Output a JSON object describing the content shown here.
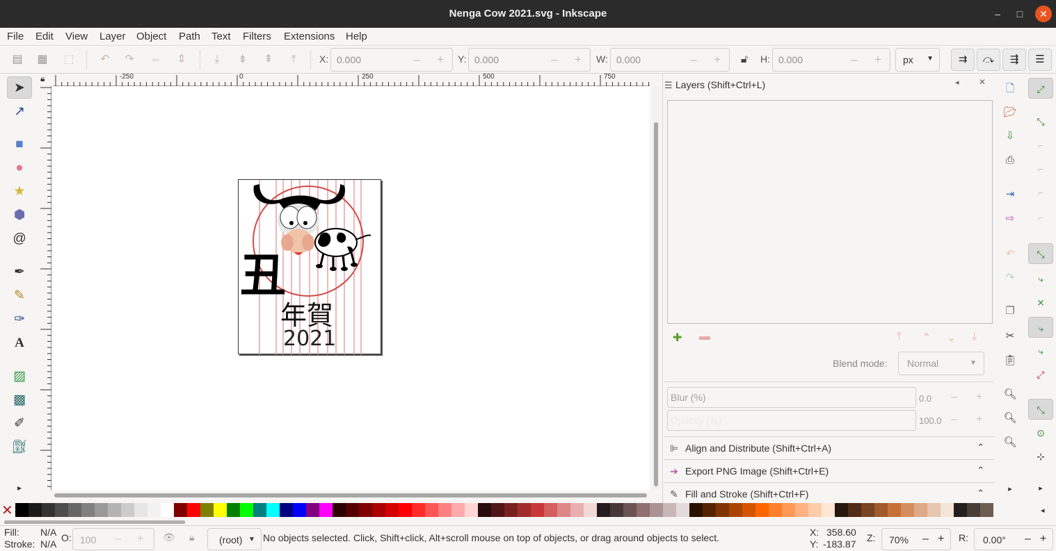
{
  "window": {
    "title": "Nenga Cow 2021.svg - Inkscape",
    "minimize": "–",
    "maximize": "□",
    "close": "✕"
  },
  "menu": [
    "File",
    "Edit",
    "View",
    "Layer",
    "Object",
    "Path",
    "Text",
    "Filters",
    "Extensions",
    "Help"
  ],
  "controls": {
    "x_label": "X:",
    "x_value": "0.000",
    "y_label": "Y:",
    "y_value": "0.000",
    "w_label": "W:",
    "w_value": "0.000",
    "h_label": "H:",
    "h_value": "0.000",
    "unit": "px",
    "minus": "–",
    "plus": "+"
  },
  "ruler": {
    "top_labels": [
      "-250",
      "0",
      "250",
      "500",
      "750"
    ]
  },
  "drawing": {
    "kanji_big": "丑",
    "kanji_small": "年賀",
    "year": "2021"
  },
  "dock": {
    "layers_title": "Layers (Shift+Ctrl+L)",
    "blend_label": "Blend mode:",
    "blend_value": "Normal",
    "blur_label": "Blur (%)",
    "blur_value": "0.0",
    "opacity_label": "Opacity (%)",
    "opacity_value": "100.0",
    "align_title": "Align and Distribute (Shift+Ctrl+A)",
    "export_title": "Export PNG Image (Shift+Ctrl+E)",
    "fill_title": "Fill and Stroke (Shift+Ctrl+F)"
  },
  "status": {
    "fill_label": "Fill:",
    "fill_value": "N/A",
    "stroke_label": "Stroke:",
    "stroke_value": "N/A",
    "opacity_label": "O:",
    "opacity_value": "100",
    "layer": "(root)",
    "message": "No objects selected. Click, Shift+click, Alt+scroll mouse on top of objects, or drag around objects to select.",
    "x_label": "X:",
    "x_value": "358.60",
    "y_label": "Y:",
    "y_value": "-183.87",
    "zoom_label": "Z:",
    "zoom_value": "70%",
    "rotate_label": "R:",
    "rotate_value": "0.00°"
  },
  "palette_colors": [
    "#000000",
    "#1a1a1a",
    "#333333",
    "#4d4d4d",
    "#666666",
    "#808080",
    "#999999",
    "#b3b3b3",
    "#cccccc",
    "#e6e6e6",
    "#f2f2f2",
    "#ffffff",
    "#800000",
    "#ff0000",
    "#808000",
    "#ffff00",
    "#008000",
    "#00ff00",
    "#008080",
    "#00ffff",
    "#000080",
    "#0000ff",
    "#800080",
    "#ff00ff",
    "#2b0000",
    "#550000",
    "#800000",
    "#aa0000",
    "#d40000",
    "#ff0000",
    "#ff2a2a",
    "#ff5555",
    "#ff8080",
    "#ffaaaa",
    "#ffd5d5",
    "#280b0b",
    "#501616",
    "#782121",
    "#a02c2c",
    "#c83737",
    "#d35f5f",
    "#de8787",
    "#e9afaf",
    "#f4d7d7",
    "#241c1c",
    "#483737",
    "#6c5353",
    "#916f6f",
    "#ac9393",
    "#c8b7b7",
    "#e3dbdb",
    "#2b1100",
    "#552200",
    "#803300",
    "#aa4400",
    "#d45500",
    "#ff6600",
    "#ff7f2a",
    "#ff9955",
    "#ffb380",
    "#ffccaa",
    "#ffe6d5",
    "#28170b",
    "#502d16",
    "#784421",
    "#a05a2c",
    "#c87137",
    "#d38d5f",
    "#deaa87",
    "#e9c6af",
    "#f4e3d7",
    "#241f1c",
    "#483e37",
    "#6c5d53"
  ]
}
